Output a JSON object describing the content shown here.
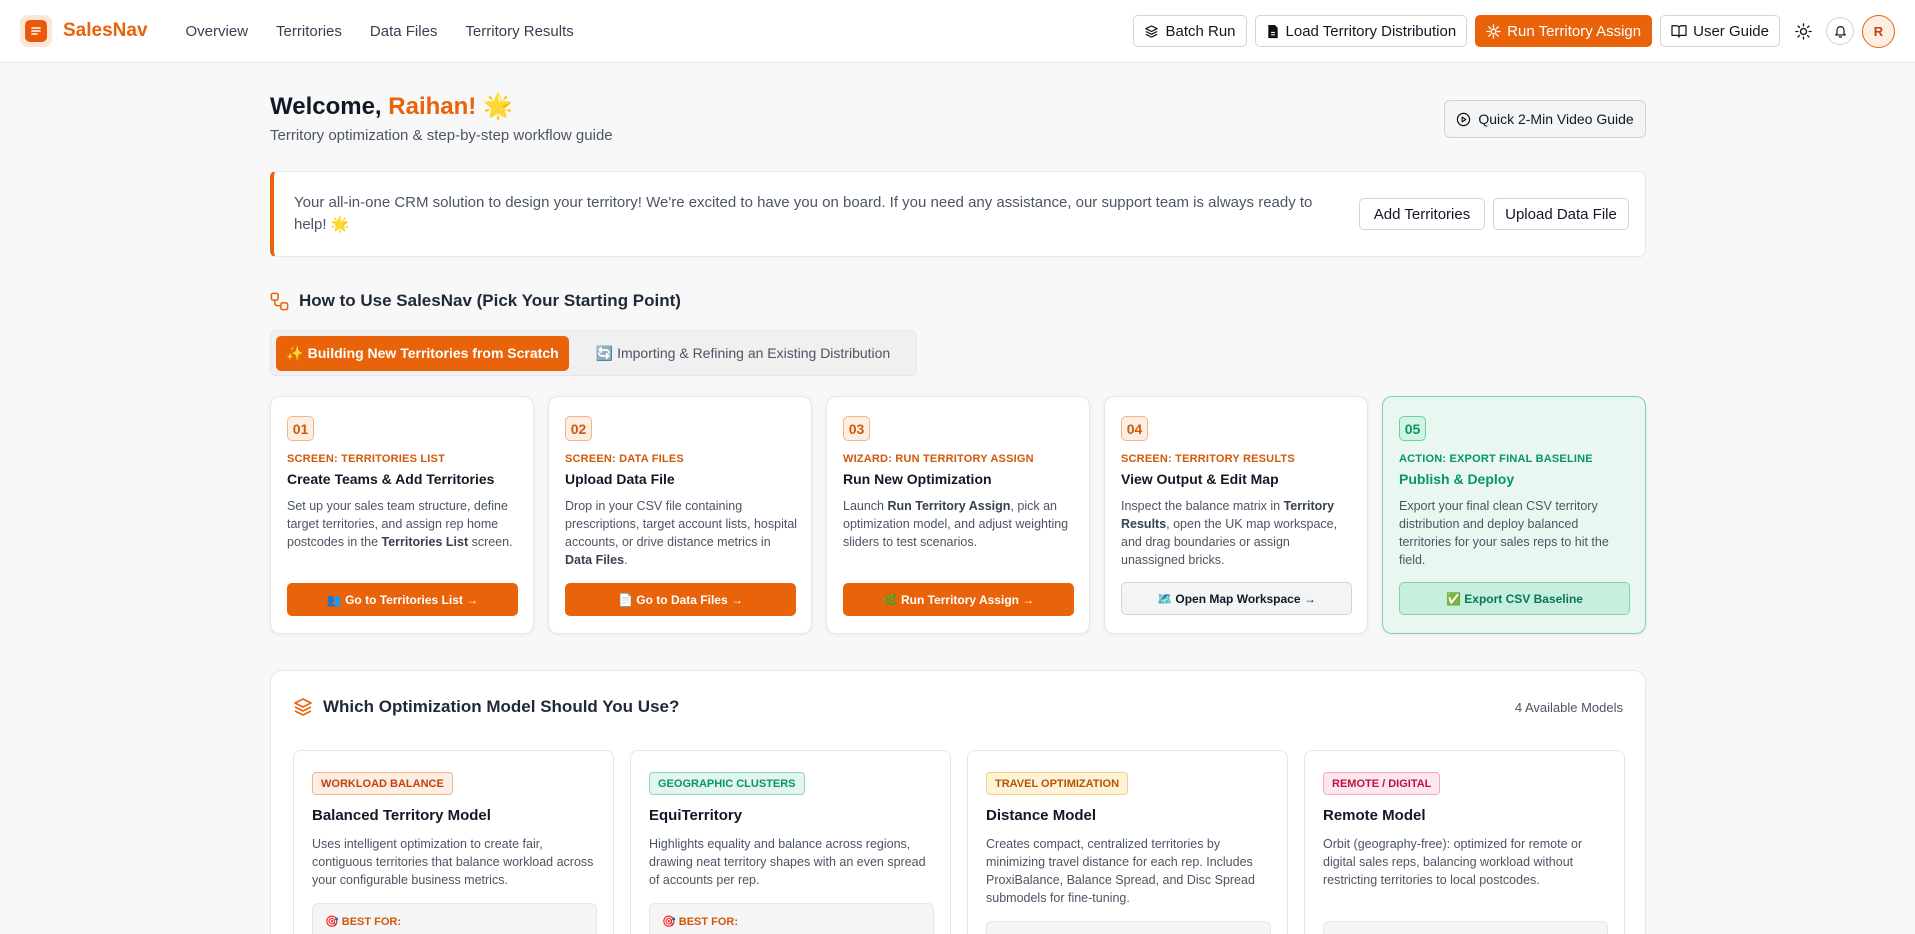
{
  "brand": "SalesNav",
  "nav": {
    "links": [
      "Overview",
      "Territories",
      "Data Files",
      "Territory Results"
    ],
    "batch_run": "Batch Run",
    "load_distribution": "Load Territory Distribution",
    "run_assign": "Run Territory Assign",
    "user_guide": "User Guide",
    "avatar_initial": "R"
  },
  "welcome": {
    "greeting": "Welcome,",
    "name": "Raihan!",
    "emoji": "🌟",
    "subtitle": "Territory optimization & step-by-step workflow guide",
    "video_button": "Quick 2-Min Video Guide"
  },
  "banner": {
    "text": "Your all-in-one CRM solution to design your territory! We're excited to have you on board. If you need any assistance, our support team is always ready to help! 🌟",
    "add_territories": "Add Territories",
    "upload_data_file": "Upload Data File"
  },
  "how_to": {
    "title": "How to Use SalesNav (Pick Your Starting Point)",
    "tab_active": "✨ Building New Territories from Scratch",
    "tab_inactive": "🔄 Importing & Refining an Existing Distribution",
    "steps": [
      {
        "num": "01",
        "kicker": "SCREEN: TERRITORIES LIST",
        "title": "Create Teams & Add Territories",
        "desc_parts": [
          "Set up your sales team structure, define target territories, and assign rep home postcodes in the ",
          "Territories List",
          " screen."
        ],
        "button": "👥 Go to Territories List →"
      },
      {
        "num": "02",
        "kicker": "SCREEN: DATA FILES",
        "title": "Upload Data File",
        "desc_parts": [
          "Drop in your CSV file containing prescriptions, target account lists, hospital accounts, or drive distance metrics in ",
          "Data Files",
          "."
        ],
        "button": "📄 Go to Data Files →"
      },
      {
        "num": "03",
        "kicker": "WIZARD: RUN TERRITORY ASSIGN",
        "title": "Run New Optimization",
        "desc_parts": [
          "Launch ",
          "Run Territory Assign",
          ", pick an optimization model, and adjust weighting sliders to test scenarios."
        ],
        "button": "🌿 Run Territory Assign →"
      },
      {
        "num": "04",
        "kicker": "SCREEN: TERRITORY RESULTS",
        "title": "View Output & Edit Map",
        "desc_parts": [
          "Inspect the balance matrix in ",
          "Territory Results",
          ", open the UK map workspace, and drag boundaries or assign unassigned bricks."
        ],
        "button": "🗺️ Open Map Workspace →"
      },
      {
        "num": "05",
        "kicker": "ACTION: EXPORT FINAL BASELINE",
        "title": "Publish & Deploy",
        "desc_parts": [
          "Export your final clean CSV territory distribution and deploy balanced territories for your sales reps to hit the field.",
          "",
          ""
        ],
        "button": "✅ Export CSV Baseline"
      }
    ]
  },
  "models": {
    "title": "Which Optimization Model Should You Use?",
    "count": "4 Available Models",
    "cards": [
      {
        "badge": "WORKLOAD BALANCE",
        "name": "Balanced Territory Model",
        "desc": "Uses intelligent optimization to create fair, contiguous territories that balance workload across your configurable business metrics.",
        "best_for": "🎯 BEST FOR:"
      },
      {
        "badge": "GEOGRAPHIC CLUSTERS",
        "name": "EquiTerritory",
        "desc": "Highlights equality and balance across regions, drawing neat territory shapes with an even spread of accounts per rep.",
        "best_for": "🎯 BEST FOR:"
      },
      {
        "badge": "TRAVEL OPTIMIZATION",
        "name": "Distance Model",
        "desc": "Creates compact, centralized territories by minimizing travel distance for each rep. Includes ProxiBalance, Balance Spread, and Disc Spread submodels for fine-tuning.",
        "best_for": ""
      },
      {
        "badge": "REMOTE / DIGITAL",
        "name": "Remote Model",
        "desc": "Orbit (geography-free): optimized for remote or digital sales reps, balancing workload without restricting territories to local postcodes.",
        "best_for": ""
      }
    ]
  },
  "colors": {
    "accent": "#e8630a",
    "success": "#059669"
  }
}
